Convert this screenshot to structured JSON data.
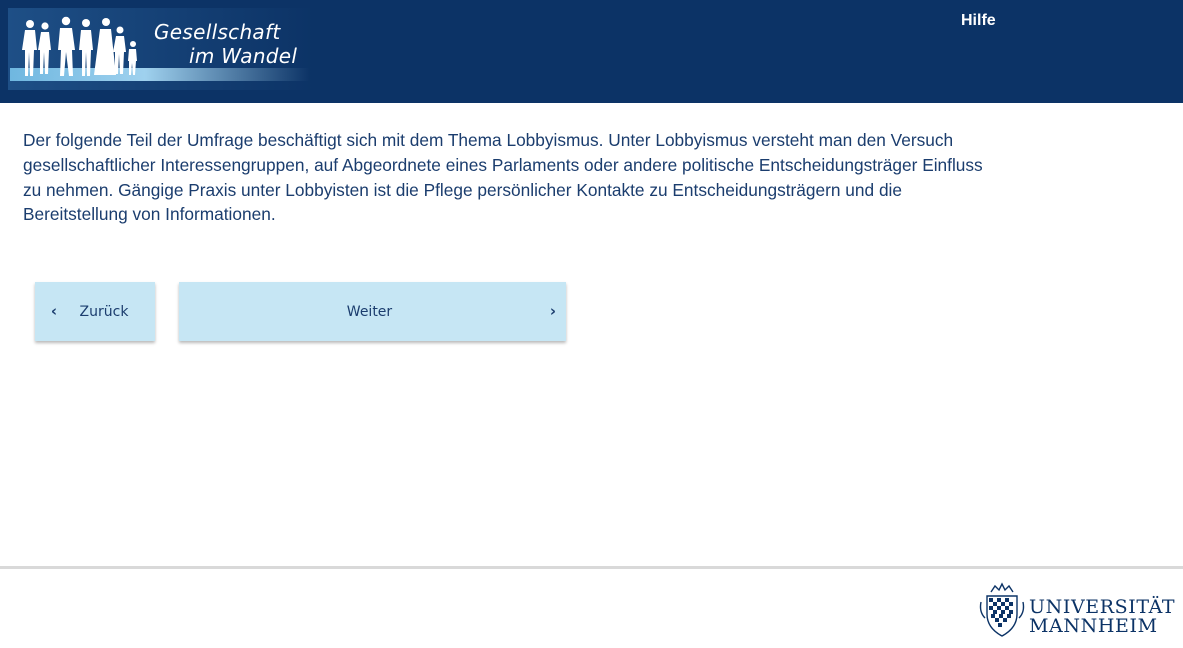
{
  "header": {
    "logo_line1": "Gesellschaft",
    "logo_line2": "im Wandel",
    "help_label": "Hilfe",
    "background_color": "#0c3366"
  },
  "main": {
    "intro_text": "Der folgende Teil der Umfrage beschäftigt sich mit dem Thema Lobbyismus. Unter Lobbyismus versteht man den Versuch gesellschaftlicher Interessengruppen, auf Abgeordnete eines Parlaments oder andere politische Entscheidungsträger Einfluss zu nehmen. Gängige Praxis unter Lobbyisten ist die Pflege persönlicher Kontakte zu Entscheidungsträgern und die Bereitstellung von Informationen."
  },
  "nav": {
    "back_label": "Zurück",
    "next_label": "Weiter",
    "back_icon": "chevron-left-icon",
    "next_icon": "chevron-right-icon",
    "button_color": "#c6e6f4"
  },
  "footer": {
    "university_line1": "UNIVERSITÄT",
    "university_line2": "MANNHEIM"
  }
}
